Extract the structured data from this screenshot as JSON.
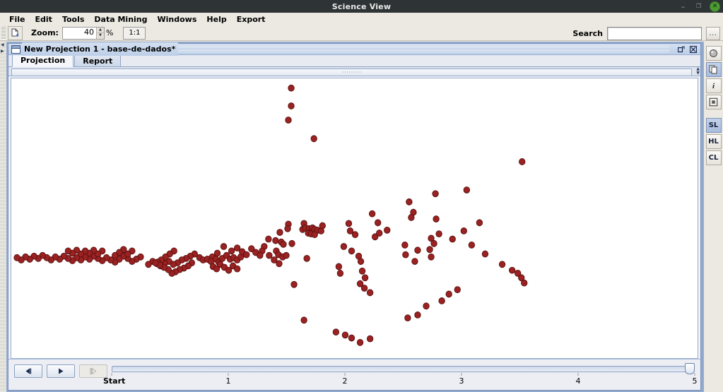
{
  "window": {
    "title": "Science View",
    "controls": {
      "minimize": "–",
      "maximize": "❐",
      "close": "✕"
    }
  },
  "menubar": {
    "items": [
      "File",
      "Edit",
      "Tools",
      "Data Mining",
      "Windows",
      "Help",
      "Export"
    ]
  },
  "toolbar": {
    "open_icon": "open-document-icon",
    "zoom_label": "Zoom:",
    "zoom_value": "40",
    "zoom_unit": "%",
    "ratio_button": "1:1",
    "search_label": "Search",
    "search_value": "",
    "search_placeholder": "",
    "more_button": "..."
  },
  "projection_window": {
    "title": "New Projection 1 - base-de-dados*",
    "maximize_icon": "⊐",
    "close_icon": "⊠",
    "tabs": [
      {
        "label": "Projection",
        "active": true
      },
      {
        "label": "Report",
        "active": false
      }
    ]
  },
  "right_toolbar": {
    "buttons": [
      {
        "name": "sphere-icon",
        "glyph": "◉",
        "selected": false,
        "type": "icon"
      },
      {
        "name": "copy-pages-icon",
        "glyph": "❐",
        "selected": true,
        "type": "icon"
      },
      {
        "name": "info-icon",
        "glyph": "i",
        "selected": false,
        "type": "icon"
      },
      {
        "name": "frame-icon",
        "glyph": "▣",
        "selected": false,
        "type": "icon"
      },
      {
        "name": "sl-button",
        "glyph": "SL",
        "selected": true,
        "type": "text"
      },
      {
        "name": "hl-button",
        "glyph": "HL",
        "selected": false,
        "type": "text"
      },
      {
        "name": "cl-button",
        "glyph": "CL",
        "selected": false,
        "type": "text"
      }
    ]
  },
  "timeline": {
    "step_back_label": "◀|",
    "play_label": "▶",
    "step_forward_label": "|▶",
    "step_forward_disabled": true,
    "start_label": "Start",
    "ticks": [
      {
        "label": "Start",
        "pos": 0
      },
      {
        "label": "1",
        "pos": 20
      },
      {
        "label": "2",
        "pos": 40
      },
      {
        "label": "3",
        "pos": 60
      },
      {
        "label": "4",
        "pos": 80
      },
      {
        "label": "5",
        "pos": 100
      }
    ],
    "value": 100
  },
  "chart_data": {
    "type": "scatter",
    "title": "",
    "xlabel": "",
    "ylabel": "",
    "point_fill": "#9b2222",
    "point_stroke": "#5a0f0f",
    "point_radius": 4.2,
    "background": "#ffffff",
    "grid": false,
    "legend": null,
    "xlim": [
      0,
      966
    ],
    "ylim": [
      0,
      376
    ],
    "note": "Pixel coordinates within the plot canvas (origin top-left); single unlabeled series of dark-red markers.",
    "series": [
      {
        "name": "projection-points",
        "points": [
          [
            394,
            13
          ],
          [
            394,
            37
          ],
          [
            390,
            56
          ],
          [
            426,
            81
          ],
          [
            719,
            112
          ],
          [
            560,
            166
          ],
          [
            597,
            155
          ],
          [
            641,
            150
          ],
          [
            566,
            180
          ],
          [
            598,
            189
          ],
          [
            508,
            182
          ],
          [
            516,
            194
          ],
          [
            518,
            208
          ],
          [
            529,
            204
          ],
          [
            512,
            213
          ],
          [
            591,
            215
          ],
          [
            589,
            230
          ],
          [
            554,
            224
          ],
          [
            555,
            237
          ],
          [
            475,
            195
          ],
          [
            477,
            205
          ],
          [
            484,
            210
          ],
          [
            390,
            196
          ],
          [
            389,
            202
          ],
          [
            412,
            195
          ],
          [
            410,
            203
          ],
          [
            414,
            201
          ],
          [
            419,
            202
          ],
          [
            424,
            201
          ],
          [
            427,
            203
          ],
          [
            431,
            204
          ],
          [
            436,
            205
          ],
          [
            418,
            208
          ],
          [
            422,
            209
          ],
          [
            427,
            210
          ],
          [
            438,
            198
          ],
          [
            378,
            207
          ],
          [
            372,
            218
          ],
          [
            380,
            220
          ],
          [
            383,
            223
          ],
          [
            395,
            222
          ],
          [
            373,
            232
          ],
          [
            376,
            237
          ],
          [
            382,
            240
          ],
          [
            387,
            238
          ],
          [
            362,
            216
          ],
          [
            356,
            226
          ],
          [
            353,
            232
          ],
          [
            363,
            238
          ],
          [
            370,
            244
          ],
          [
            468,
            226
          ],
          [
            479,
            232
          ],
          [
            489,
            239
          ],
          [
            461,
            253
          ],
          [
            463,
            262
          ],
          [
            492,
            246
          ],
          [
            494,
            259
          ],
          [
            498,
            268
          ],
          [
            491,
            276
          ],
          [
            497,
            282
          ],
          [
            505,
            288
          ],
          [
            416,
            242
          ],
          [
            398,
            277
          ],
          [
            377,
            249
          ],
          [
            299,
            226
          ],
          [
            290,
            235
          ],
          [
            283,
            240
          ],
          [
            288,
            243
          ],
          [
            292,
            247
          ],
          [
            297,
            242
          ],
          [
            303,
            238
          ],
          [
            308,
            243
          ],
          [
            313,
            241
          ],
          [
            318,
            244
          ],
          [
            323,
            240
          ],
          [
            265,
            241
          ],
          [
            270,
            244
          ],
          [
            276,
            243
          ],
          [
            281,
            246
          ],
          [
            258,
            236
          ],
          [
            252,
            239
          ],
          [
            246,
            242
          ],
          [
            240,
            244
          ],
          [
            234,
            248
          ],
          [
            228,
            250
          ],
          [
            222,
            246
          ],
          [
            216,
            249
          ],
          [
            210,
            252
          ],
          [
            205,
            249
          ],
          [
            199,
            246
          ],
          [
            193,
            250
          ],
          [
            229,
            232
          ],
          [
            223,
            236
          ],
          [
            217,
            240
          ],
          [
            211,
            244
          ],
          [
            206,
            247
          ],
          [
            254,
            248
          ],
          [
            249,
            252
          ],
          [
            243,
            255
          ],
          [
            237,
            257
          ],
          [
            231,
            260
          ],
          [
            226,
            262
          ],
          [
            221,
            257
          ],
          [
            215,
            254
          ],
          [
            209,
            251
          ],
          [
            203,
            248
          ],
          [
            182,
            240
          ],
          [
            176,
            243
          ],
          [
            170,
            246
          ],
          [
            164,
            242
          ],
          [
            158,
            239
          ],
          [
            152,
            243
          ],
          [
            146,
            247
          ],
          [
            140,
            244
          ],
          [
            134,
            241
          ],
          [
            128,
            245
          ],
          [
            122,
            242
          ],
          [
            116,
            239
          ],
          [
            110,
            243
          ],
          [
            104,
            240
          ],
          [
            98,
            244
          ],
          [
            92,
            241
          ],
          [
            86,
            245
          ],
          [
            80,
            242
          ],
          [
            74,
            239
          ],
          [
            68,
            243
          ],
          [
            62,
            240
          ],
          [
            56,
            244
          ],
          [
            50,
            241
          ],
          [
            44,
            238
          ],
          [
            38,
            242
          ],
          [
            32,
            239
          ],
          [
            26,
            243
          ],
          [
            20,
            240
          ],
          [
            14,
            244
          ],
          [
            8,
            241
          ],
          [
            170,
            232
          ],
          [
            164,
            236
          ],
          [
            158,
            230
          ],
          [
            152,
            234
          ],
          [
            146,
            238
          ],
          [
            128,
            232
          ],
          [
            122,
            236
          ],
          [
            116,
            231
          ],
          [
            110,
            235
          ],
          [
            104,
            232
          ],
          [
            98,
            236
          ],
          [
            92,
            231
          ],
          [
            86,
            235
          ],
          [
            80,
            232
          ],
          [
            310,
            232
          ],
          [
            318,
            228
          ],
          [
            325,
            233
          ],
          [
            331,
            237
          ],
          [
            338,
            229
          ],
          [
            344,
            234
          ],
          [
            350,
            238
          ],
          [
            284,
            253
          ],
          [
            289,
            256
          ],
          [
            294,
            250
          ],
          [
            300,
            254
          ],
          [
            306,
            258
          ],
          [
            312,
            252
          ],
          [
            318,
            256
          ],
          [
            412,
            325
          ],
          [
            457,
            341
          ],
          [
            470,
            345
          ],
          [
            479,
            349
          ],
          [
            491,
            355
          ],
          [
            505,
            350
          ],
          [
            558,
            322
          ],
          [
            572,
            318
          ],
          [
            584,
            306
          ],
          [
            606,
            299
          ],
          [
            616,
            290
          ],
          [
            628,
            284
          ],
          [
            591,
            240
          ],
          [
            568,
            246
          ],
          [
            637,
            205
          ],
          [
            659,
            194
          ],
          [
            563,
            187
          ],
          [
            602,
            209
          ],
          [
            572,
            231
          ],
          [
            595,
            222
          ],
          [
            621,
            216
          ],
          [
            648,
            224
          ],
          [
            667,
            236
          ],
          [
            691,
            250
          ],
          [
            705,
            258
          ],
          [
            713,
            262
          ],
          [
            718,
            268
          ],
          [
            722,
            275
          ]
        ]
      }
    ]
  }
}
